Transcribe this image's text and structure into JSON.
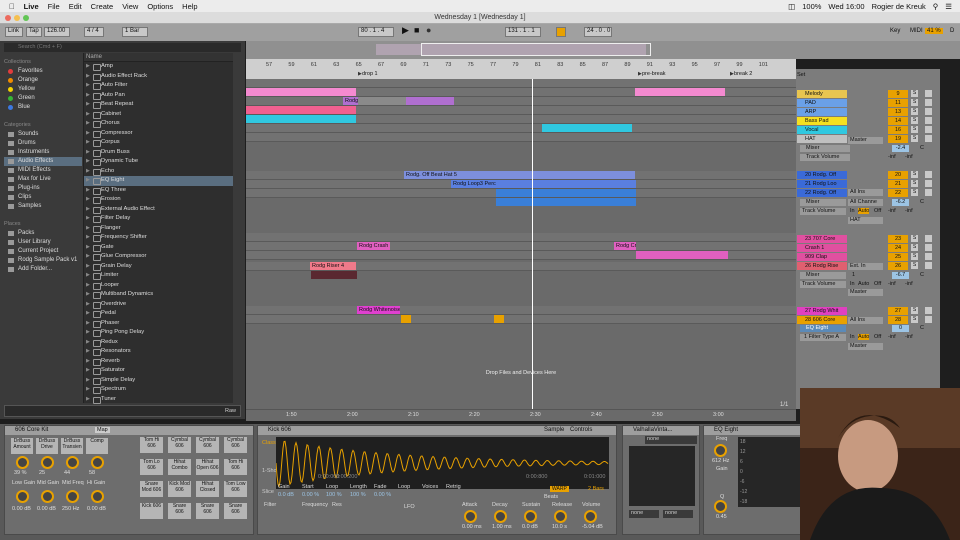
{
  "menubar": {
    "app": "Live",
    "items": [
      "File",
      "Edit",
      "Create",
      "View",
      "Options",
      "Help"
    ],
    "battery": "100%",
    "time": "Wed 16:00",
    "user": "Rogier de Kreuk"
  },
  "window": {
    "title": "Wednesday 1  [Wednesday 1]"
  },
  "transport": {
    "link": "Link",
    "tap": "Tap",
    "tempo": "126.00",
    "sig": "4 / 4",
    "quant": "1 Bar",
    "pos": "80 .   1 .   4",
    "pos2": "131 .   1 .   1",
    "end": "24 .   0 .   0",
    "key": "Key",
    "midi": "MIDI",
    "cpu": "41 %",
    "d": "D"
  },
  "browser": {
    "search": "Search (Cmd + F)",
    "collections_h": "Collections",
    "collections": [
      {
        "l": "Favorites",
        "c": "#e23c3c"
      },
      {
        "l": "Orange",
        "c": "#f08c00"
      },
      {
        "l": "Yellow",
        "c": "#f5d200"
      },
      {
        "l": "Green",
        "c": "#36b536"
      },
      {
        "l": "Blue",
        "c": "#3c78e0"
      }
    ],
    "categories_h": "Categories",
    "categories": [
      "Sounds",
      "Drums",
      "Instruments",
      "Audio Effects",
      "MIDI Effects",
      "Max for Live",
      "Plug-ins",
      "Clips",
      "Samples"
    ],
    "places_h": "Places",
    "places": [
      "Packs",
      "User Library",
      "Current Project",
      "Rodg Sample Pack v1",
      "Add Folder..."
    ],
    "name_h": "Name",
    "items": [
      "Amp",
      "Audio Effect Rack",
      "Auto Filter",
      "Auto Pan",
      "Beat Repeat",
      "Cabinet",
      "Chorus",
      "Compressor",
      "Corpus",
      "Drum Buss",
      "Dynamic Tube",
      "Echo",
      "EQ Eight",
      "EQ Three",
      "Erosion",
      "External Audio Effect",
      "Filter Delay",
      "Flanger",
      "Frequency Shifter",
      "Gate",
      "Glue Compressor",
      "Grain Delay",
      "Limiter",
      "Looper",
      "Multiband Dynamics",
      "Overdrive",
      "Pedal",
      "Phaser",
      "Ping Pong Delay",
      "Redux",
      "Resonators",
      "Reverb",
      "Saturator",
      "Simple Delay",
      "Spectrum",
      "Tuner"
    ],
    "preview_raw": "Raw"
  },
  "ruler": {
    "bars": [
      "57",
      "59",
      "61",
      "63",
      "65",
      "67",
      "69",
      "71",
      "73",
      "75",
      "77",
      "79",
      "81",
      "83",
      "85",
      "87",
      "89",
      "91",
      "93",
      "95",
      "97",
      "99",
      "101"
    ],
    "locators": [
      "drop 1",
      "pre-break",
      "break 2"
    ],
    "times": [
      "1:50",
      "2:00",
      "2:10",
      "2:20",
      "2:30",
      "2:40",
      "2:50",
      "3:00"
    ],
    "drop_label": "Drop Files and Devices Here",
    "zoom": "1/1"
  },
  "clips": [
    "Rodg 5th Bass 7",
    "Rodg 5th Bass 7",
    "Rodg. Off Beat Hat 5",
    "Rodg Loop3 Perc",
    "Rodg Crash 3",
    "Rodg Cra",
    "Rodg Riser 4",
    "Rodg Whitenoise"
  ],
  "tracks": [
    {
      "n": "Melody",
      "c": "#e8c550",
      "v": "9"
    },
    {
      "n": "PAD",
      "c": "#6aa0e8",
      "v": "11"
    },
    {
      "n": "ARP",
      "c": "#6aa0e8",
      "v": "13"
    },
    {
      "n": "Bass Pad",
      "c": "#f5e020",
      "v": "14"
    },
    {
      "n": "Vocal",
      "c": "#30c8e0",
      "v": "16"
    },
    {
      "n": "HAT",
      "c": "#c0c0c0",
      "v": "19"
    },
    {
      "n": "20 Rodg. Off",
      "c": "#3a6ad8",
      "v": "20"
    },
    {
      "n": "21 Rodg Loo",
      "c": "#3a6ad8",
      "v": "21"
    },
    {
      "n": "22 Rodg. Off",
      "c": "#3a6ad8",
      "v": "22"
    },
    {
      "n": "23 707 Core",
      "c": "#e050a0",
      "v": "23"
    },
    {
      "n": "Crash 1",
      "c": "#e050a0",
      "v": "24"
    },
    {
      "n": "909 Clap",
      "c": "#e050a0",
      "v": "25"
    },
    {
      "n": "26 Rodg Rise",
      "c": "#e06070",
      "v": "26"
    },
    {
      "n": "27 Rodg Whit",
      "c": "#e040c0",
      "v": "27"
    },
    {
      "n": "28 606 Core",
      "c": "#e8a100",
      "v": "28"
    }
  ],
  "mixer": {
    "master": "Master",
    "mixer": "Mixer",
    "track_vol": "Track Volume",
    "hat": "HAT",
    "all_ins": "All Ins",
    "all_chan": "All Channe",
    "ext_in": "Ext. In",
    "in": "In",
    "auto": "Auto",
    "off": "Off",
    "inf": "-inf",
    "v1": "-2.4",
    "v2": "-6.2",
    "v3": "-6.7",
    "zero": "0",
    "c": "C",
    "one": "1",
    "eq8": "EQ Eight",
    "filter": "1 Filter Type A"
  },
  "devices": {
    "kit": "606 Core Kit",
    "map": "Map",
    "macros": [
      "DrBuss Amount",
      "DrBuss Drive",
      "DrBuss Transien",
      "Comp"
    ],
    "macro_vals": [
      "39 %",
      "25",
      "44",
      "58"
    ],
    "macros2": [
      "Low Gain",
      "Mid Gain",
      "Mid Freq",
      "Hi Gain"
    ],
    "macro_vals2": [
      "0.00 dB",
      "0.00 dB",
      "250 Hz",
      "0.00 dB"
    ],
    "pads": [
      "Tom Hi 606",
      "Cymbal 606",
      "Cymbal 606",
      "Cymbal 606",
      "Tom Lo 606",
      "Hihat Combo",
      "Hihat Open 606",
      "Tom Hi 606",
      "Snare Mod 606",
      "Kick Mod 606",
      "Hihat Closed",
      "Tom Low 606",
      "Kick 606",
      "Snare 606",
      "Snare 606",
      "Snare 606"
    ],
    "sampler": "Kick 606",
    "sample": "Sample",
    "controls": "Controls",
    "classic": "Classic",
    "oneshot": "1-Shot",
    "slice": "Slice",
    "sp": [
      "Gain",
      "Start",
      "Loop",
      "Length",
      "Fade",
      "Loop",
      "Voices",
      "Retrig"
    ],
    "spv": [
      "0.0 dB",
      "0.00 %",
      "100 %",
      "100 %",
      "0.00 %"
    ],
    "warp": "WARP",
    "beats": "Beats",
    "bars2": "2 Bars",
    "t0": "0:00:000",
    "t1": "0:00:200",
    "t2": "0:00:800",
    "t3": "0:01:000",
    "filt": "Filter",
    "freq": "Frequency",
    "res": "Res",
    "lfo": "LFO",
    "attack": "Attack",
    "decay": "Decay",
    "sustain": "Sustain",
    "release": "Release",
    "volume": "Volume",
    "av": "0.00 ms",
    "dv": "1.00 ms",
    "sv": "0.0 dB",
    "rv": "10.0 s",
    "vv": "-5.04 dB",
    "valhalla": "ValhallaVinta...",
    "none": "none",
    "eq": "EQ Eight",
    "freq_l": "Freq",
    "freq_v": "612 Hz",
    "gain_l": "Gain",
    "q_l": "Q",
    "q_v": "0.45",
    "eqdb": [
      "18",
      "12",
      "6",
      "0",
      "-6",
      "-12",
      "-18"
    ]
  }
}
